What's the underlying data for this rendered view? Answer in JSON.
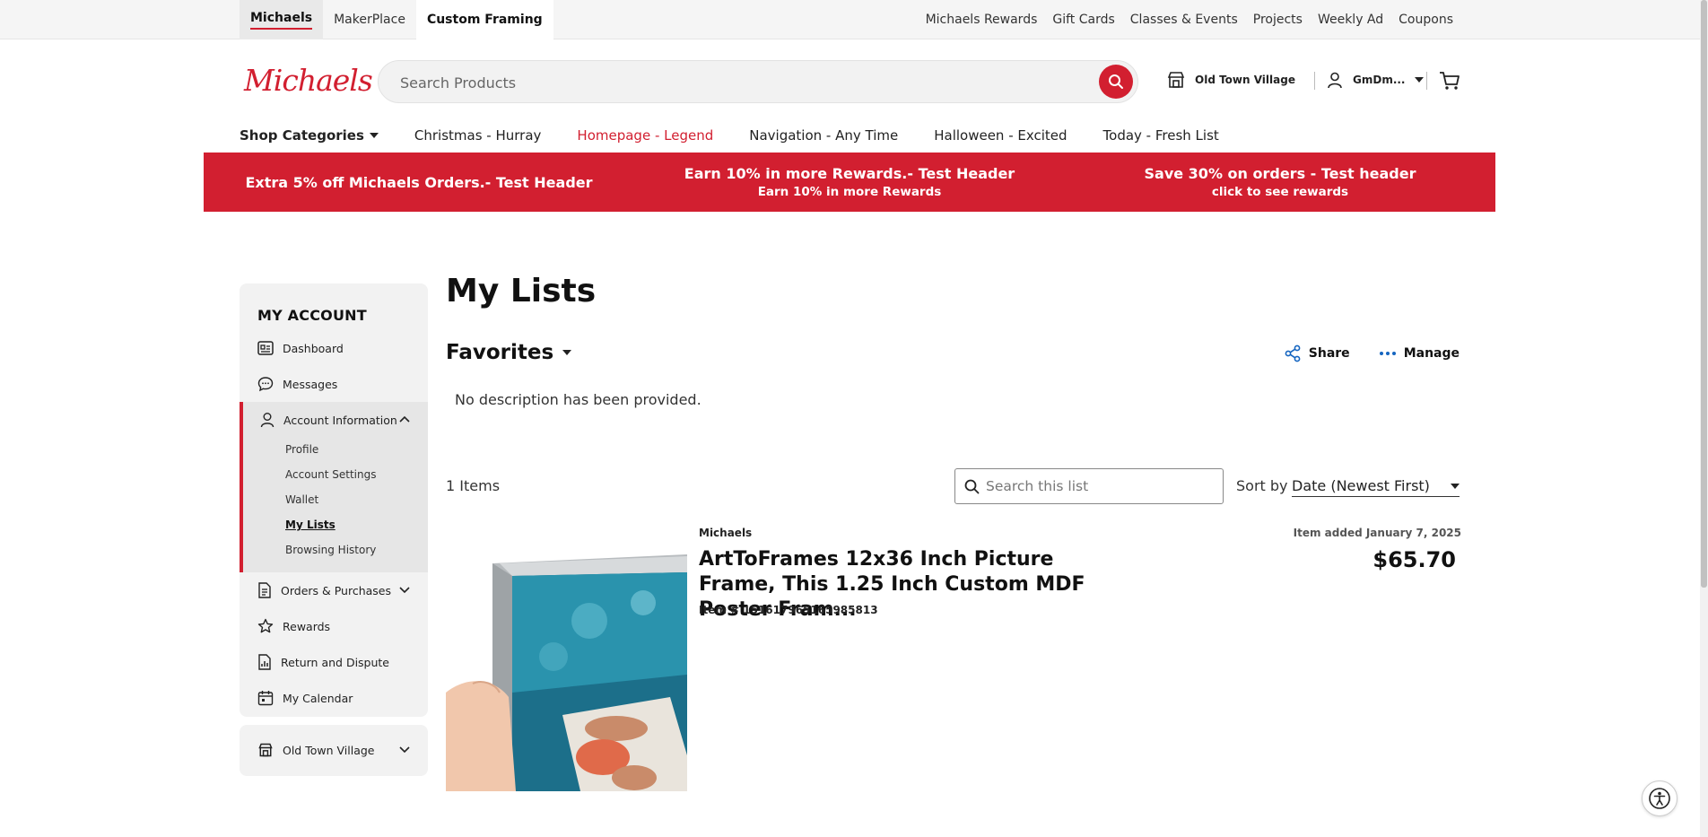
{
  "topbar": {
    "site_tabs": [
      {
        "label": "Michaels"
      },
      {
        "label": "MakerPlace"
      },
      {
        "label": "Custom Framing"
      }
    ],
    "links": [
      {
        "label": "Michaels Rewards"
      },
      {
        "label": "Gift Cards"
      },
      {
        "label": "Classes & Events"
      },
      {
        "label": "Projects"
      },
      {
        "label": "Weekly Ad"
      },
      {
        "label": "Coupons"
      }
    ]
  },
  "header": {
    "logo": "Michaels",
    "search_placeholder": "Search Products",
    "store": "Old Town Village",
    "account_name": "GmDm..."
  },
  "nav": {
    "categories_label": "Shop Categories",
    "items": [
      {
        "label": "Christmas - Hurray"
      },
      {
        "label": "Homepage - Legend"
      },
      {
        "label": "Navigation - Any Time"
      },
      {
        "label": "Halloween - Excited"
      },
      {
        "label": "Today - Fresh List"
      }
    ]
  },
  "banner": {
    "color": "#d21f30",
    "promos": [
      {
        "main": "Extra 5% off Michaels Orders.- Test Header",
        "sub": ""
      },
      {
        "main": "Earn 10% in more Rewards.- Test Header",
        "sub": "Earn 10% in more Rewards"
      },
      {
        "main": "Save 30% on orders - Test header",
        "sub": "click to see rewards"
      }
    ]
  },
  "sidebar": {
    "title": "MY ACCOUNT",
    "items": {
      "dashboard": "Dashboard",
      "messages": "Messages",
      "account_information": "Account Information",
      "orders": "Orders & Purchases",
      "rewards": "Rewards",
      "return": "Return and Dispute",
      "calendar": "My Calendar"
    },
    "sub_items": {
      "profile": "Profile",
      "settings": "Account Settings",
      "wallet": "Wallet",
      "my_lists": "My Lists",
      "history": "Browsing History"
    },
    "store": "Old Town Village"
  },
  "main": {
    "title": "My Lists",
    "list_name": "Favorites",
    "share_label": "Share",
    "manage_label": "Manage",
    "description": "No description has been provided.",
    "item_count": "1 Items",
    "list_search_placeholder": "Search this list",
    "sort_label": "Sort by",
    "sort_value": "Date (Newest First)",
    "product": {
      "brand": "Michaels",
      "title": "ArtToFrames 12x36 Inch Picture Frame, This 1.25 Inch Custom MDF Poster Fram...",
      "item_number": "Item # 151617965165985813",
      "added": "Item added January 7, 2025",
      "price": "$65.70"
    }
  }
}
